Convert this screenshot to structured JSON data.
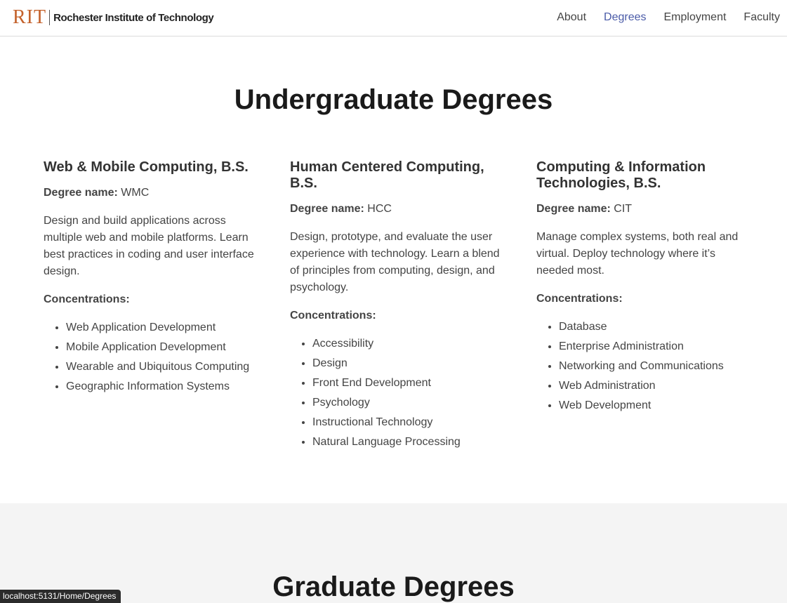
{
  "nav": {
    "brand_mark": "RIT",
    "brand_name": "Rochester Institute of Technology",
    "links": [
      "About",
      "Degrees",
      "Employment",
      "Faculty"
    ],
    "active": "Degrees",
    "accent_color": "#4a5ba8",
    "brand_color": "#c4622c"
  },
  "undergrad": {
    "title": "Undergraduate Degrees",
    "degree_name_label": "Degree name:",
    "concentrations_label": "Concentrations:",
    "degrees": [
      {
        "title": "Web & Mobile Computing, B.S.",
        "name": "WMC",
        "description": "Design and build applications across multiple web and mobile platforms. Learn best practices in coding and user interface design.",
        "concentrations": [
          "Web Application Development",
          "Mobile Application Development",
          "Wearable and Ubiquitous Computing",
          "Geographic Information Systems"
        ]
      },
      {
        "title": "Human Centered Computing, B.S.",
        "name": "HCC",
        "description": "Design, prototype, and evaluate the user experience with technology. Learn a blend of principles from computing, design, and psychology.",
        "concentrations": [
          "Accessibility",
          "Design",
          "Front End Development",
          "Psychology",
          "Instructional Technology",
          "Natural Language Processing"
        ]
      },
      {
        "title": "Computing & Information Technologies, B.S.",
        "name": "CIT",
        "description": "Manage complex systems, both real and virtual. Deploy technology where it’s needed most.",
        "concentrations": [
          "Database",
          "Enterprise Administration",
          "Networking and Communications",
          "Web Administration",
          "Web Development"
        ]
      }
    ]
  },
  "graduate": {
    "title": "Graduate Degrees"
  },
  "status_bar": {
    "url": "localhost:5131/Home/Degrees"
  }
}
